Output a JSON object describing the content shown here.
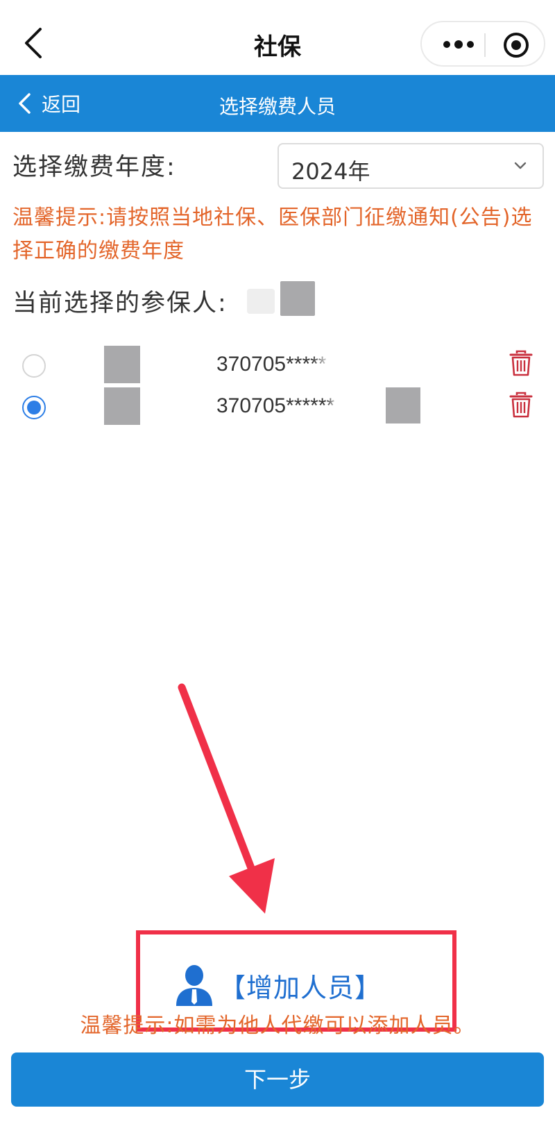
{
  "topbar": {
    "title": "社保",
    "back_icon": "chevron-left-icon",
    "more_icon": "more-dots-icon",
    "close_icon": "target-circle-icon"
  },
  "nav": {
    "back_label": "返回",
    "title": "选择缴费人员",
    "background": "#1a86d6"
  },
  "year": {
    "label": "选择缴费年度:",
    "selected": "2024年"
  },
  "tip_top": "温馨提示:请按照当地社保、医保部门征缴通知(公告)选择正确的缴费年度",
  "current": {
    "label": "当前选择的参保人:"
  },
  "persons": [
    {
      "id_number": "370705*****",
      "selected": false
    },
    {
      "id_number": "370705******",
      "selected": true
    }
  ],
  "add_person": {
    "label": "【增加人员】",
    "icon": "person-icon"
  },
  "tip_bottom": "温馨提示:如需为他人代缴可以添加人员。",
  "next_button": "下一步",
  "colors": {
    "primary": "#1a86d6",
    "tip": "#e3652a",
    "radio_on": "#2d7ee6",
    "trash": "#c9303e",
    "annotation": "#f03048"
  }
}
